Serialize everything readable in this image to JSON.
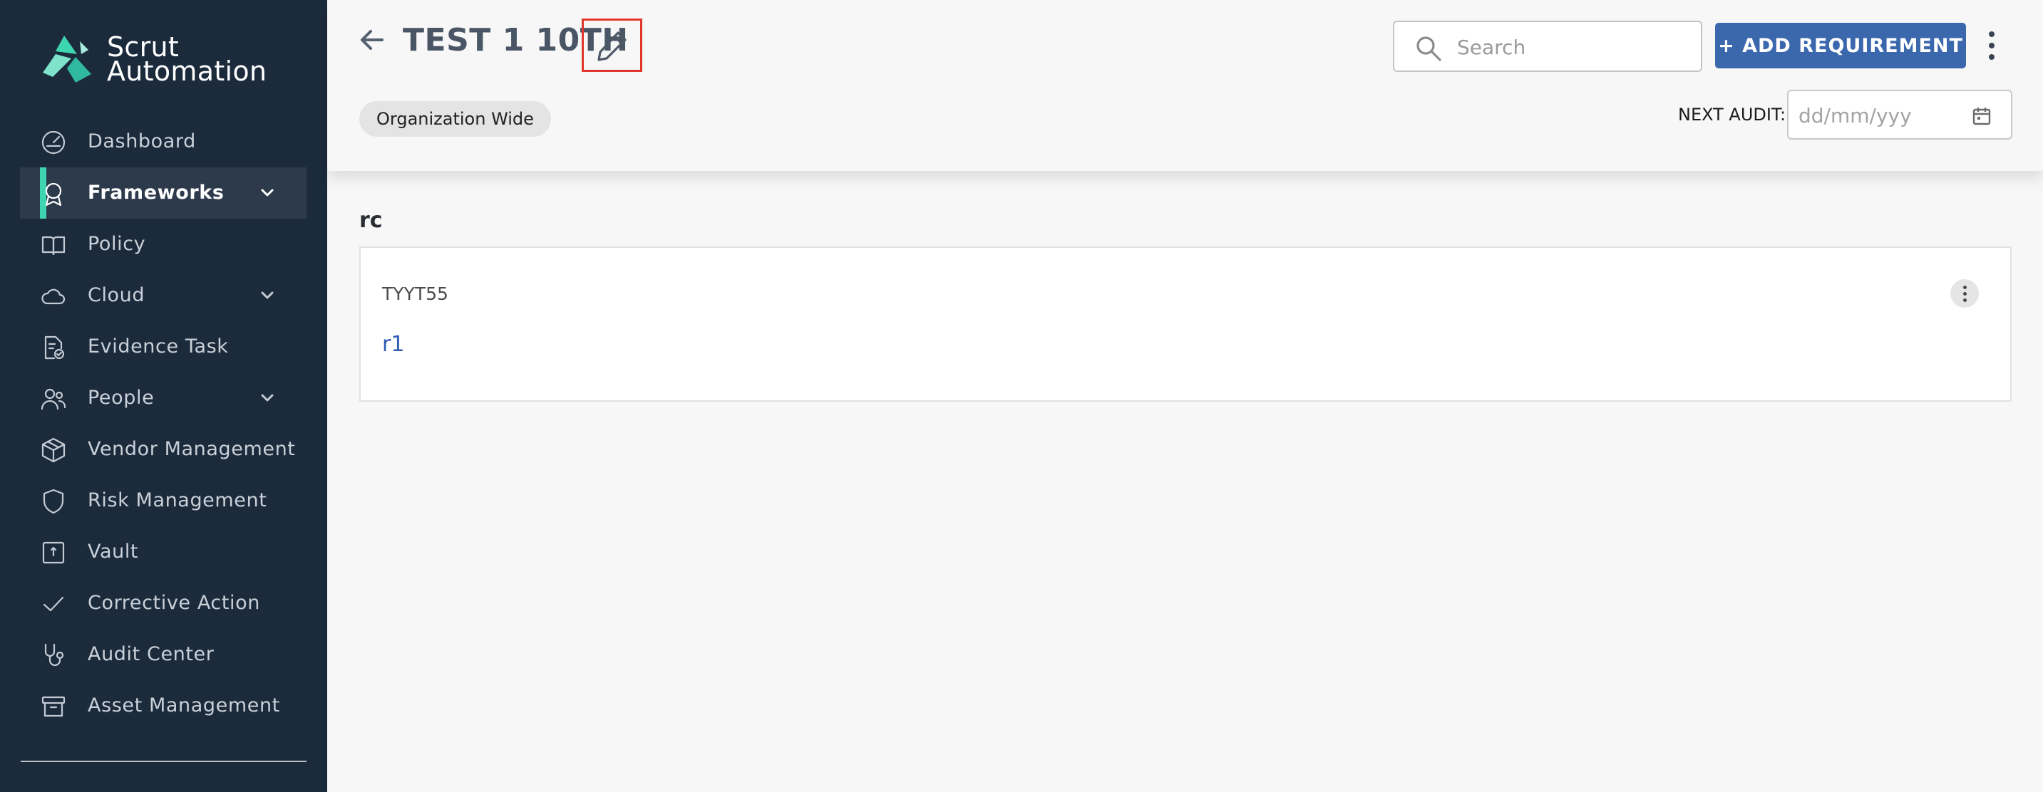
{
  "brand": {
    "line1": "Scrut",
    "line2": "Automation",
    "accent": "#3ed6b0"
  },
  "sidebar": {
    "items": [
      {
        "label": "Dashboard",
        "icon": "dashboard-icon",
        "expandable": false
      },
      {
        "label": "Frameworks",
        "icon": "award-icon",
        "expandable": true,
        "active": true
      },
      {
        "label": "Policy",
        "icon": "book-icon",
        "expandable": false
      },
      {
        "label": "Cloud",
        "icon": "cloud-icon",
        "expandable": true
      },
      {
        "label": "Evidence Task",
        "icon": "document-check-icon",
        "expandable": false
      },
      {
        "label": "People",
        "icon": "people-icon",
        "expandable": true
      },
      {
        "label": "Vendor Management",
        "icon": "box-icon",
        "expandable": false
      },
      {
        "label": "Risk Management",
        "icon": "shield-icon",
        "expandable": false
      },
      {
        "label": "Vault",
        "icon": "vault-icon",
        "expandable": false
      },
      {
        "label": "Corrective Action",
        "icon": "checkmark-icon",
        "expandable": false
      },
      {
        "label": "Audit Center",
        "icon": "stethoscope-icon",
        "expandable": false
      },
      {
        "label": "Asset Management",
        "icon": "archive-icon",
        "expandable": false
      }
    ]
  },
  "header": {
    "title": "TEST 1 10TH",
    "scope_chip": "Organization Wide",
    "search_placeholder": "Search",
    "add_button": "+ ADD REQUIREMENT",
    "next_audit_label": "NEXT AUDIT:",
    "next_audit_placeholder": "dd/mm/yyy"
  },
  "section": {
    "title": "rc",
    "card": {
      "code": "TYYT55",
      "link": "r1"
    }
  },
  "colors": {
    "sidebar_bg": "#1c2b3c",
    "primary_button": "#3b67ad",
    "highlight_box": "#e0362c",
    "link": "#2e5db3"
  }
}
